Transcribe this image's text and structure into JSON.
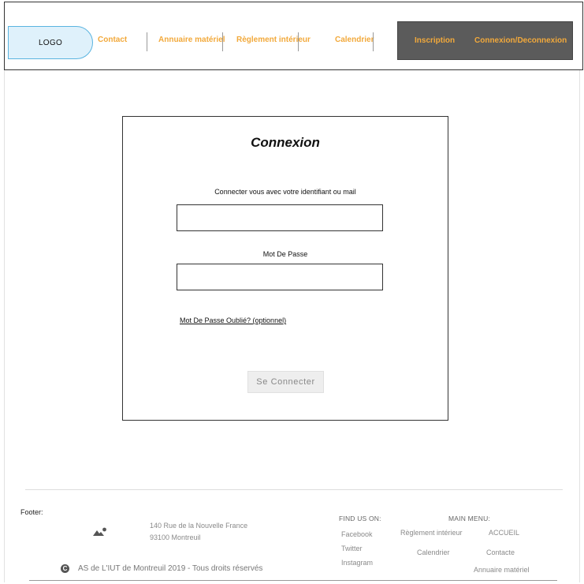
{
  "header": {
    "logo": "LOGO",
    "nav": {
      "contact": "Contact",
      "annuaire": "Annuaire matériel",
      "reglement": "Règlement intérieur",
      "calendrier": "Calendrier",
      "inscription": "Inscription",
      "connexion": "Connexion/Deconnexion"
    }
  },
  "login": {
    "title": "Connexion",
    "identifier_label": "Connecter vous avec votre identifiant ou mail",
    "identifier_value": "",
    "password_label": "Mot De Passe",
    "password_value": "",
    "forgot_link": "Mot De Passe Oublié? (optionnel)",
    "submit_label": "Se Connecter"
  },
  "footer": {
    "label": "Footer:",
    "address_line1": "140 Rue de la Nouvelle France",
    "address_line2": "93100 Montreuil",
    "find_us_heading": "FIND US ON:",
    "social": [
      "Facebook",
      "Twitter",
      "Instagram"
    ],
    "main_menu_heading": "MAIN MENU:",
    "menu": {
      "reglement": "Règlement intérieur",
      "accueil": "ACCUEIL",
      "calendrier": "Calendrier",
      "contacte": "Contacte",
      "annuaire": "Annuaire matériel"
    },
    "copyright": "AS de L'IUT de Montreuil 2019 -  Tous droits réservés"
  },
  "colors": {
    "nav_link": "#f2a93b",
    "nav_dark_bg": "#5b5b5b",
    "logo_bg": "#dff1fb",
    "logo_border": "#5ab4e0"
  },
  "icons": {
    "footer_image": "image-icon",
    "copyright": "copyright-icon"
  }
}
